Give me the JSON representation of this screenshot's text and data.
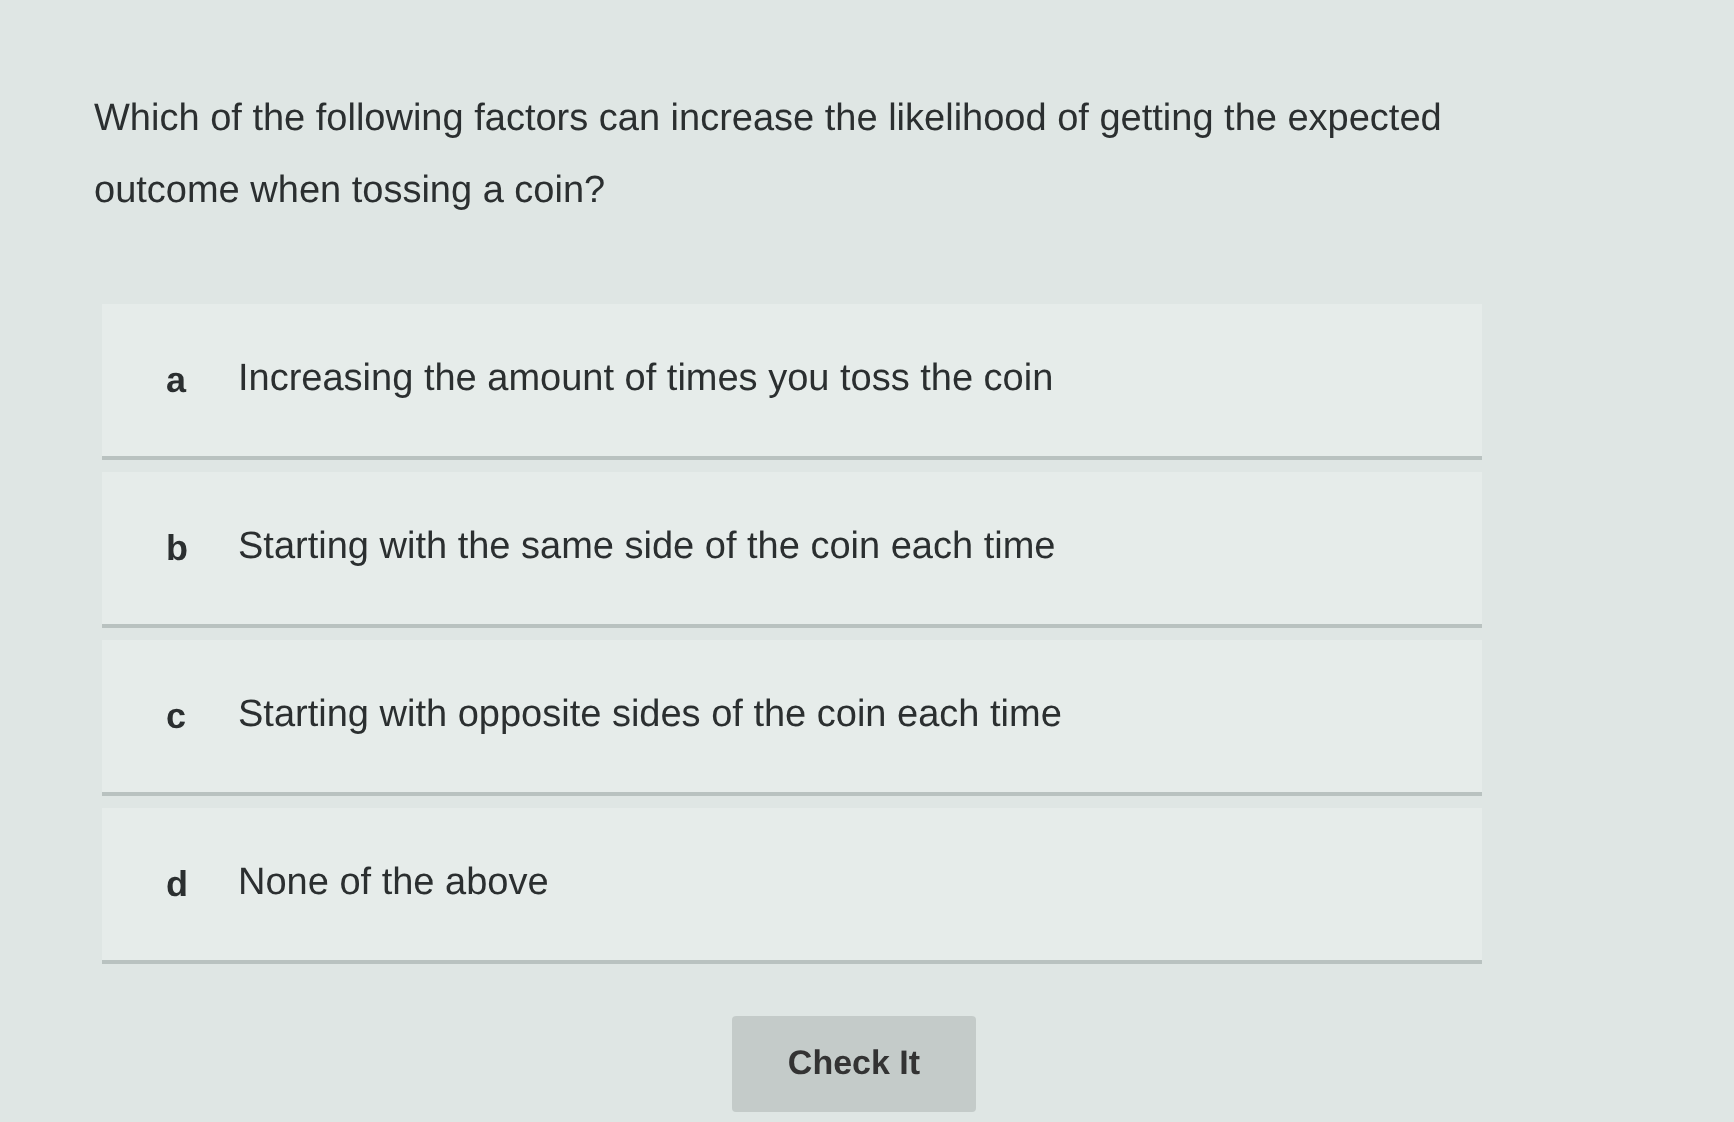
{
  "question": "Which of the following factors can increase the likelihood of getting the expected outcome when tossing a coin?",
  "options": [
    {
      "letter": "a",
      "text": "Increasing the amount of times you toss the coin"
    },
    {
      "letter": "b",
      "text": "Starting with the same side of the coin each time"
    },
    {
      "letter": "c",
      "text": "Starting with opposite sides of the coin each time"
    },
    {
      "letter": "d",
      "text": "None of the above"
    }
  ],
  "button": "Check It"
}
